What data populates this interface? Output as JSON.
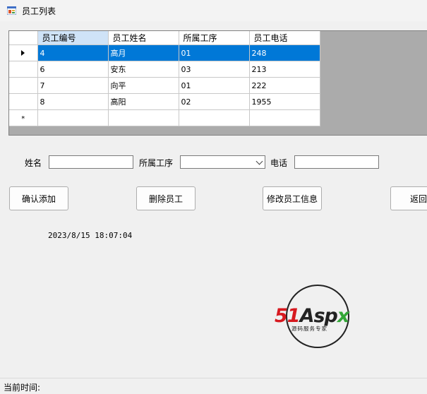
{
  "window": {
    "title": "员工列表"
  },
  "grid": {
    "columns": [
      "员工编号",
      "员工姓名",
      "所属工序",
      "员工电话"
    ],
    "rows": [
      [
        "4",
        "高月",
        "01",
        "248"
      ],
      [
        "6",
        "安东",
        "03",
        "213"
      ],
      [
        "7",
        "向平",
        "01",
        "222"
      ],
      [
        "8",
        "高阳",
        "02",
        "1955"
      ]
    ],
    "new_row_marker": "*"
  },
  "form": {
    "name_label": "姓名",
    "name_value": "",
    "process_label": "所属工序",
    "process_value": "",
    "phone_label": "电话",
    "phone_value": ""
  },
  "buttons": {
    "add": "确认添加",
    "delete": "删除员工",
    "edit": "修改员工信息",
    "back": "返回"
  },
  "datetime": "2023/8/15 18:07:04",
  "logo": {
    "text_51": "51",
    "text_asp": "Asp",
    "text_x": "x",
    "subtitle": "源码服务专家"
  },
  "status": {
    "label": "当前时间:"
  },
  "colors": {
    "selection": "#0078d7",
    "logo_red": "#d7191f",
    "logo_green": "#33a637"
  }
}
